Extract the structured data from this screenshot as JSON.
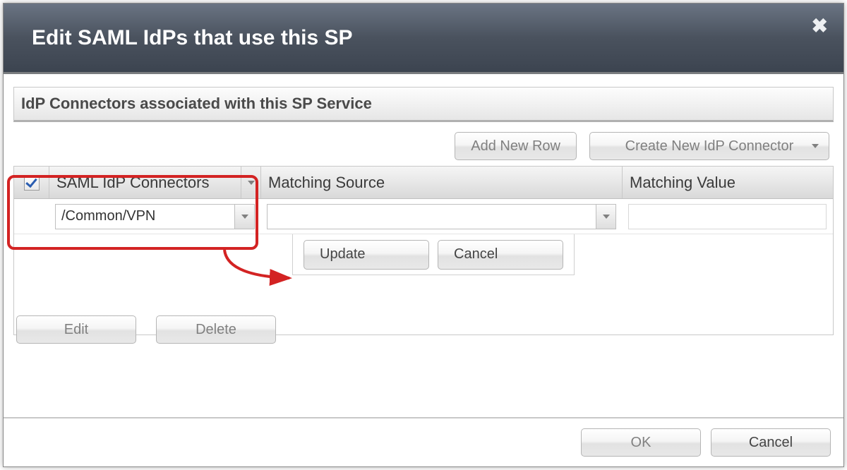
{
  "dialog": {
    "title": "Edit SAML IdPs that use this SP",
    "close_label": "Close"
  },
  "section": {
    "title": "IdP Connectors associated with this SP Service"
  },
  "toolbar": {
    "add_row": "Add New Row",
    "create_connector": "Create New IdP Connector"
  },
  "table": {
    "columns": {
      "connectors": "SAML IdP Connectors",
      "matching_source": "Matching Source",
      "matching_value": "Matching Value"
    },
    "rows": [
      {
        "checked": true,
        "connector": "/Common/VPN",
        "matching_source": "",
        "matching_value": ""
      }
    ]
  },
  "row_actions": {
    "update": "Update",
    "cancel": "Cancel"
  },
  "bottom_actions": {
    "edit": "Edit",
    "delete": "Delete"
  },
  "footer": {
    "ok": "OK",
    "cancel": "Cancel"
  }
}
